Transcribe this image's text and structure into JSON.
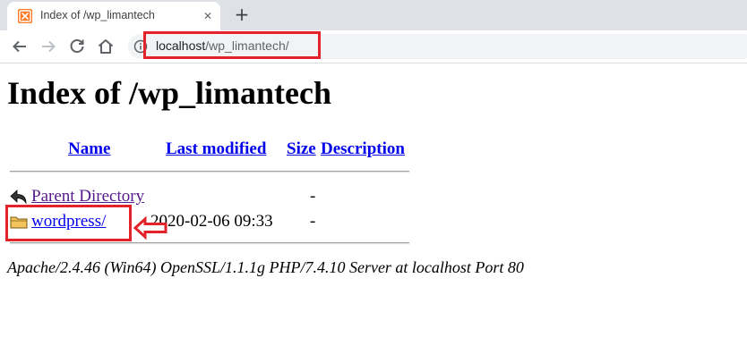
{
  "browser": {
    "tab": {
      "title": "Index of /wp_limantech",
      "favicon": "xampp-icon",
      "close_glyph": "✕"
    },
    "new_tab_glyph": "+",
    "nav_icons": [
      "back-arrow-icon",
      "forward-arrow-icon",
      "reload-icon",
      "home-icon"
    ],
    "address_bar": {
      "host": "localhost",
      "path": "/wp_limantech/",
      "icon": "info-icon"
    }
  },
  "page": {
    "heading": "Index of /wp_limantech",
    "columns": {
      "name": "Name",
      "last_modified": "Last modified",
      "size": "Size",
      "description": "Description"
    },
    "rows": [
      {
        "icon": "back-arrow-icon",
        "name": "Parent Directory",
        "last_modified": "",
        "size": "-",
        "description": ""
      },
      {
        "icon": "folder-icon",
        "name": "wordpress/",
        "last_modified": "2020-02-06 09:33",
        "size": "-",
        "description": ""
      }
    ],
    "address": "Apache/2.4.46 (Win64) OpenSSL/1.1.1g PHP/7.4.10 Server at localhost Port 80"
  },
  "annotations": {
    "highlight_color": "#e3222a",
    "arrow_icon": "left-arrow-annotation-icon"
  },
  "colors": {
    "link": "#0000ee",
    "visited_link": "#551a8b",
    "tabstrip": "#dee1e6",
    "favicon": "#fb7a24"
  }
}
